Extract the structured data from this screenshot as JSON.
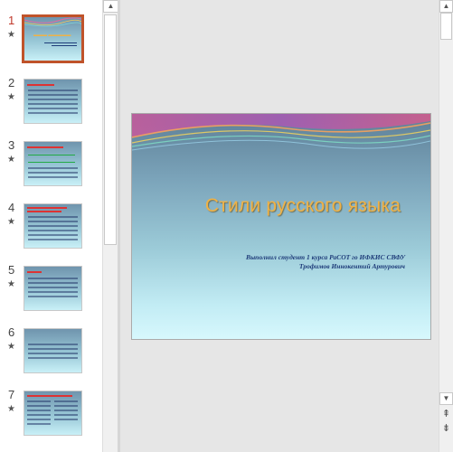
{
  "thumbnails": [
    {
      "number": "1",
      "active": true
    },
    {
      "number": "2",
      "active": false
    },
    {
      "number": "3",
      "active": false
    },
    {
      "number": "4",
      "active": false
    },
    {
      "number": "5",
      "active": false
    },
    {
      "number": "6",
      "active": false
    },
    {
      "number": "7",
      "active": false
    }
  ],
  "thumb_star_icon": "star-icon",
  "slide": {
    "title": "Стили  русского языка",
    "subtitle_line1": "Выполнил  студент 1 курса   РаСОТ  го   ИФКИС СВФУ",
    "subtitle_line2": "Трофимов  Иннокентий Артурович"
  },
  "colors": {
    "accent_active": "#c0532a",
    "title_color": "#f0b246",
    "subtitle_color": "#1f3d7a"
  },
  "icons": {
    "scroll_up": "▲",
    "scroll_down": "▼",
    "prev_slide": "⇞",
    "next_slide": "⇟"
  }
}
